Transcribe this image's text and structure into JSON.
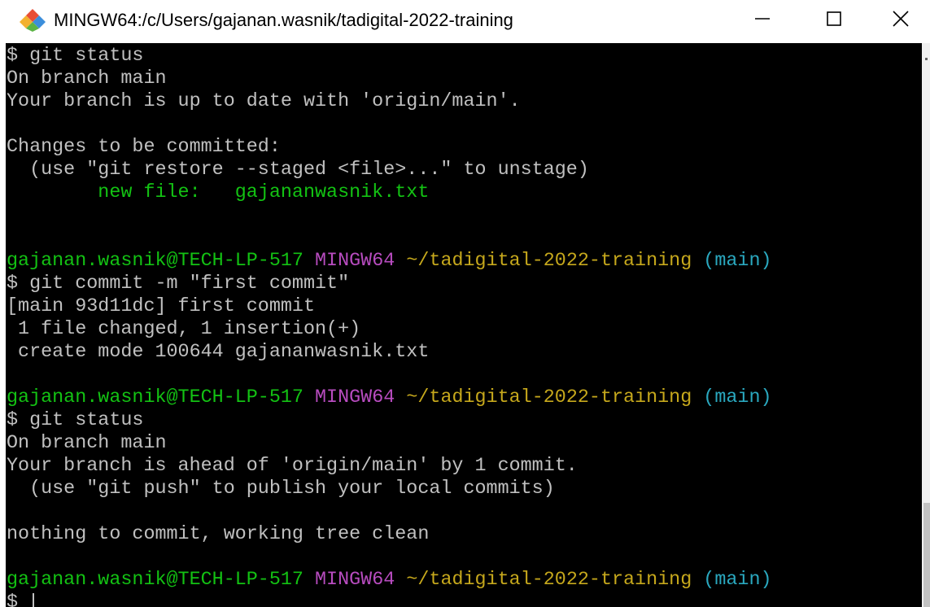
{
  "window": {
    "title": "MINGW64:/c/Users/gajanan.wasnik/tadigital-2022-training",
    "icon": "git-bash-diamond-icon",
    "controls": {
      "minimize_icon": "minimize-icon",
      "maximize_icon": "maximize-icon",
      "close_icon": "close-icon"
    }
  },
  "colors": {
    "background": "#000000",
    "default_text": "#c0c0c0",
    "user_host": "#13c213",
    "mingw": "#b84cc0",
    "path": "#c6a81c",
    "branch": "#2aa8bf",
    "staged_file": "#13c213"
  },
  "terminal": {
    "lines": [
      [
        {
          "text": "$ git status",
          "style": "default"
        }
      ],
      [
        {
          "text": "On branch main",
          "style": "default"
        }
      ],
      [
        {
          "text": "Your branch is up to date with 'origin/main'.",
          "style": "default"
        }
      ],
      [
        {
          "text": "",
          "style": "default"
        }
      ],
      [
        {
          "text": "Changes to be committed:",
          "style": "default"
        }
      ],
      [
        {
          "text": "  (use \"git restore --staged <file>...\" to unstage)",
          "style": "default"
        }
      ],
      [
        {
          "text": "        new file:   gajananwasnik.txt",
          "style": "green"
        }
      ],
      [
        {
          "text": "",
          "style": "default"
        }
      ],
      [
        {
          "text": "",
          "style": "default"
        }
      ],
      [
        {
          "text": "gajanan.wasnik@TECH-LP-517",
          "style": "green"
        },
        {
          "text": " ",
          "style": "default"
        },
        {
          "text": "MINGW64",
          "style": "magenta"
        },
        {
          "text": " ",
          "style": "default"
        },
        {
          "text": "~/tadigital-2022-training",
          "style": "yellow"
        },
        {
          "text": " ",
          "style": "default"
        },
        {
          "text": "(main)",
          "style": "cyan"
        }
      ],
      [
        {
          "text": "$ git commit -m \"first commit\"",
          "style": "default"
        }
      ],
      [
        {
          "text": "[main 93d11dc] first commit",
          "style": "default"
        }
      ],
      [
        {
          "text": " 1 file changed, 1 insertion(+)",
          "style": "default"
        }
      ],
      [
        {
          "text": " create mode 100644 gajananwasnik.txt",
          "style": "default"
        }
      ],
      [
        {
          "text": "",
          "style": "default"
        }
      ],
      [
        {
          "text": "gajanan.wasnik@TECH-LP-517",
          "style": "green"
        },
        {
          "text": " ",
          "style": "default"
        },
        {
          "text": "MINGW64",
          "style": "magenta"
        },
        {
          "text": " ",
          "style": "default"
        },
        {
          "text": "~/tadigital-2022-training",
          "style": "yellow"
        },
        {
          "text": " ",
          "style": "default"
        },
        {
          "text": "(main)",
          "style": "cyan"
        }
      ],
      [
        {
          "text": "$ git status",
          "style": "default"
        }
      ],
      [
        {
          "text": "On branch main",
          "style": "default"
        }
      ],
      [
        {
          "text": "Your branch is ahead of 'origin/main' by 1 commit.",
          "style": "default"
        }
      ],
      [
        {
          "text": "  (use \"git push\" to publish your local commits)",
          "style": "default"
        }
      ],
      [
        {
          "text": "",
          "style": "default"
        }
      ],
      [
        {
          "text": "nothing to commit, working tree clean",
          "style": "default"
        }
      ],
      [
        {
          "text": "",
          "style": "default"
        }
      ],
      [
        {
          "text": "gajanan.wasnik@TECH-LP-517",
          "style": "green"
        },
        {
          "text": " ",
          "style": "default"
        },
        {
          "text": "MINGW64",
          "style": "magenta"
        },
        {
          "text": " ",
          "style": "default"
        },
        {
          "text": "~/tadigital-2022-training",
          "style": "yellow"
        },
        {
          "text": " ",
          "style": "default"
        },
        {
          "text": "(main)",
          "style": "cyan"
        }
      ],
      [
        {
          "text": "$ ",
          "style": "default",
          "cursor": true
        }
      ]
    ]
  }
}
